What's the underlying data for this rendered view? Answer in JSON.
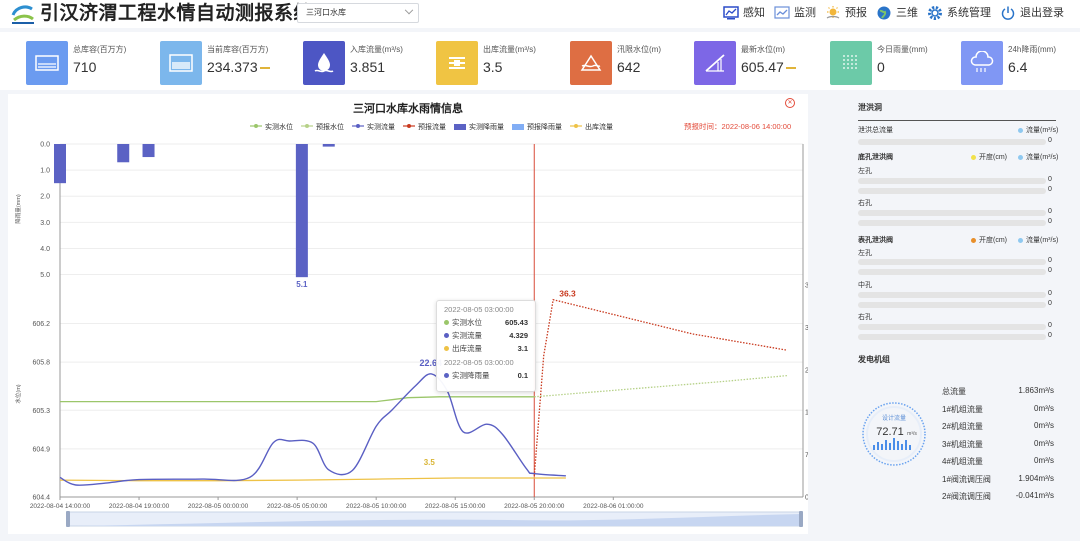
{
  "header": {
    "title": "引汉济渭工程水情自动测报系统",
    "reservoir_select": "三河口水库",
    "nav": [
      {
        "label": "感知",
        "icon": "monitor-chart-icon",
        "color": "#2b4cc8"
      },
      {
        "label": "监测",
        "icon": "line-chart-icon",
        "color": "#2b4cc8"
      },
      {
        "label": "预报",
        "icon": "weather-sun-icon",
        "color": "#e7a72c"
      },
      {
        "label": "三维",
        "icon": "globe-icon",
        "color": "#2a74c9"
      },
      {
        "label": "系统管理",
        "icon": "gear-icon",
        "color": "#2a74c9"
      },
      {
        "label": "退出登录",
        "icon": "power-icon",
        "color": "#2a74c9"
      }
    ]
  },
  "cards": [
    {
      "label": "总库容(百万方)",
      "value": "710",
      "icon": "reservoir-icon",
      "color": "#6b9bf0",
      "trend": false
    },
    {
      "label": "当前库容(百万方)",
      "value": "234.373",
      "icon": "storage-icon",
      "color": "#7cb7ec",
      "trend": true
    },
    {
      "label": "入库流量(m³/s)",
      "value": "3.851",
      "icon": "water-drop-icon",
      "color": "#4d56c4",
      "trend": false
    },
    {
      "label": "出库流量(m³/s)",
      "value": "3.5",
      "icon": "outflow-icon",
      "color": "#f0c443",
      "trend": false
    },
    {
      "label": "汛限水位(m)",
      "value": "642",
      "icon": "flood-limit-icon",
      "color": "#de6e43",
      "trend": false
    },
    {
      "label": "最新水位(m)",
      "value": "605.47",
      "icon": "water-level-icon",
      "color": "#7d67e6",
      "trend": true
    },
    {
      "label": "今日雨量(mm)",
      "value": "0",
      "icon": "rain-today-icon",
      "color": "#6ccaa8",
      "trend": false
    },
    {
      "label": "24h降雨(mm)",
      "value": "6.4",
      "icon": "rain-cloud-icon",
      "color": "#8097f4",
      "trend": false
    }
  ],
  "chart_data": {
    "type": "line",
    "title": "三河口水库水雨情信息",
    "forecast_time_label": "预报时间：2022-08-06 14:00:00",
    "legend": [
      {
        "name": "实测水位",
        "color": "#9bc66a"
      },
      {
        "name": "预报水位",
        "color": "#b6d188"
      },
      {
        "name": "实测流量",
        "color": "#5a5fc3"
      },
      {
        "name": "预报流量",
        "color": "#c93a1f"
      },
      {
        "name": "实测降雨量",
        "color": "#5b62c4"
      },
      {
        "name": "预报降雨量",
        "color": "#82aef5"
      },
      {
        "name": "出库流量",
        "color": "#eec246"
      }
    ],
    "x_ticks": [
      "2022-08-04 14:00:00",
      "2022-08-04 19:00:00",
      "2022-08-05 00:00:00",
      "2022-08-05 05:00:00",
      "2022-08-05 10:00:00",
      "2022-08-05 15:00:00",
      "2022-08-05 20:00:00",
      "2022-08-06 01:00:00"
    ],
    "rain_axis": {
      "label": "降雨量(mm)",
      "ticks": [
        "0.0",
        "1.0",
        "2.0",
        "3.0",
        "4.0",
        "5.0"
      ],
      "ylim": [
        0,
        5.4
      ]
    },
    "level_axis": {
      "label": "水位(m)",
      "ticks": [
        "604.4",
        "604.9",
        "605.3",
        "605.8",
        "606.2"
      ],
      "ylim": [
        604.4,
        606.6
      ]
    },
    "flow_axis": {
      "label": "流量(m³/s)",
      "ticks": [
        "0.0",
        "7.8",
        "15.6",
        "23.4",
        "31.2",
        "39.0"
      ],
      "ylim": [
        0,
        39.0
      ]
    },
    "rain": [
      {
        "t": 0,
        "v": 1.5
      },
      {
        "t": 4,
        "v": 0.7
      },
      {
        "t": 5.6,
        "v": 0.5
      },
      {
        "t": 15.3,
        "v": 5.1
      },
      {
        "t": 17,
        "v": 0.1
      }
    ],
    "rain_label": "5.1",
    "level_observed": [
      [
        0,
        605.39
      ],
      [
        5,
        605.39
      ],
      [
        10,
        605.39
      ],
      [
        15,
        605.39
      ],
      [
        20,
        605.39
      ],
      [
        21,
        605.41
      ],
      [
        22,
        605.43
      ],
      [
        24,
        605.44
      ],
      [
        30,
        605.44
      ]
    ],
    "level_forecast": [
      [
        30,
        605.44
      ],
      [
        36,
        605.52
      ],
      [
        42,
        605.6
      ],
      [
        46,
        605.66
      ]
    ],
    "flow_observed": [
      [
        0,
        3.6
      ],
      [
        1,
        2.2
      ],
      [
        3,
        2.6
      ],
      [
        5,
        3.2
      ],
      [
        9,
        3.3
      ],
      [
        12,
        3.6
      ],
      [
        13.5,
        10.0
      ],
      [
        14.5,
        10.3
      ],
      [
        16,
        9.9
      ],
      [
        17,
        5.0
      ],
      [
        18.5,
        4.9
      ],
      [
        20,
        13.0
      ],
      [
        21,
        16.0
      ],
      [
        22.5,
        20.5
      ],
      [
        23.5,
        22.64
      ],
      [
        24.5,
        19.5
      ],
      [
        25.5,
        12.0
      ],
      [
        27,
        13.4
      ],
      [
        28,
        11.5
      ],
      [
        29.5,
        5.2
      ],
      [
        30,
        4.3
      ],
      [
        32,
        3.9
      ]
    ],
    "flow_forecast": [
      [
        30,
        3.9
      ],
      [
        30.6,
        26.0
      ],
      [
        31.2,
        36.3
      ],
      [
        33,
        35.0
      ],
      [
        40,
        30.0
      ],
      [
        46,
        27.0
      ]
    ],
    "outflow": [
      [
        0,
        3.1
      ],
      [
        5,
        3.0
      ],
      [
        10,
        3.0
      ],
      [
        15,
        3.1
      ],
      [
        20,
        3.3
      ],
      [
        25,
        3.5
      ],
      [
        30,
        3.5
      ],
      [
        32,
        3.5
      ]
    ],
    "flow_peak_label": "22.64",
    "forecast_peak_label": "36.3",
    "outflow_label": "3.5",
    "x_max": 47,
    "forecast_line_t": 30
  },
  "tooltip": {
    "time1": "2022-08-05 03:00:00",
    "rows1": [
      {
        "name": "实测水位",
        "value": "605.43",
        "color": "#9bc66a"
      },
      {
        "name": "实测流量",
        "value": "4.329",
        "color": "#5a5fc3"
      },
      {
        "name": "出库流量",
        "value": "3.1",
        "color": "#eec246"
      }
    ],
    "time2": "2022-08-05 03:00:00",
    "rows2": [
      {
        "name": "实测降雨量",
        "value": "0.1",
        "color": "#5b62c4"
      }
    ]
  },
  "side": {
    "spillway": {
      "title": "泄洪洞",
      "total_label": "泄洪总流量",
      "legend_flow": "流量(m³/s)",
      "total_value": "0"
    },
    "bottom_gate": {
      "title": "底孔泄洪阀",
      "legend_open": "开度(cm)",
      "legend_flow": "流量(m³/s)",
      "left": "左孔",
      "right": "右孔",
      "values": [
        "0",
        "0",
        "0",
        "0"
      ]
    },
    "surface_gate": {
      "title": "表孔泄洪阀",
      "legend_open": "开度(cm)",
      "legend_flow": "流量(m³/s)",
      "left": "左孔",
      "mid": "中孔",
      "right": "右孔",
      "values": [
        "0",
        "0",
        "0",
        "0",
        "0",
        "0"
      ]
    },
    "generator": {
      "title": "发电机组",
      "gauge_label": "设计流量",
      "gauge_value": "72.71",
      "gauge_unit": "m³/s",
      "rows": [
        {
          "label": "总流量",
          "value": "1.863m³/s"
        },
        {
          "label": "1#机组流量",
          "value": "0m³/s"
        },
        {
          "label": "2#机组流量",
          "value": "0m³/s"
        },
        {
          "label": "3#机组流量",
          "value": "0m³/s"
        },
        {
          "label": "4#机组流量",
          "value": "0m³/s"
        },
        {
          "label": "1#阀流调压阀",
          "value": "1.904m³/s"
        },
        {
          "label": "2#阀流调压阀",
          "value": "-0.041m³/s"
        }
      ]
    }
  }
}
